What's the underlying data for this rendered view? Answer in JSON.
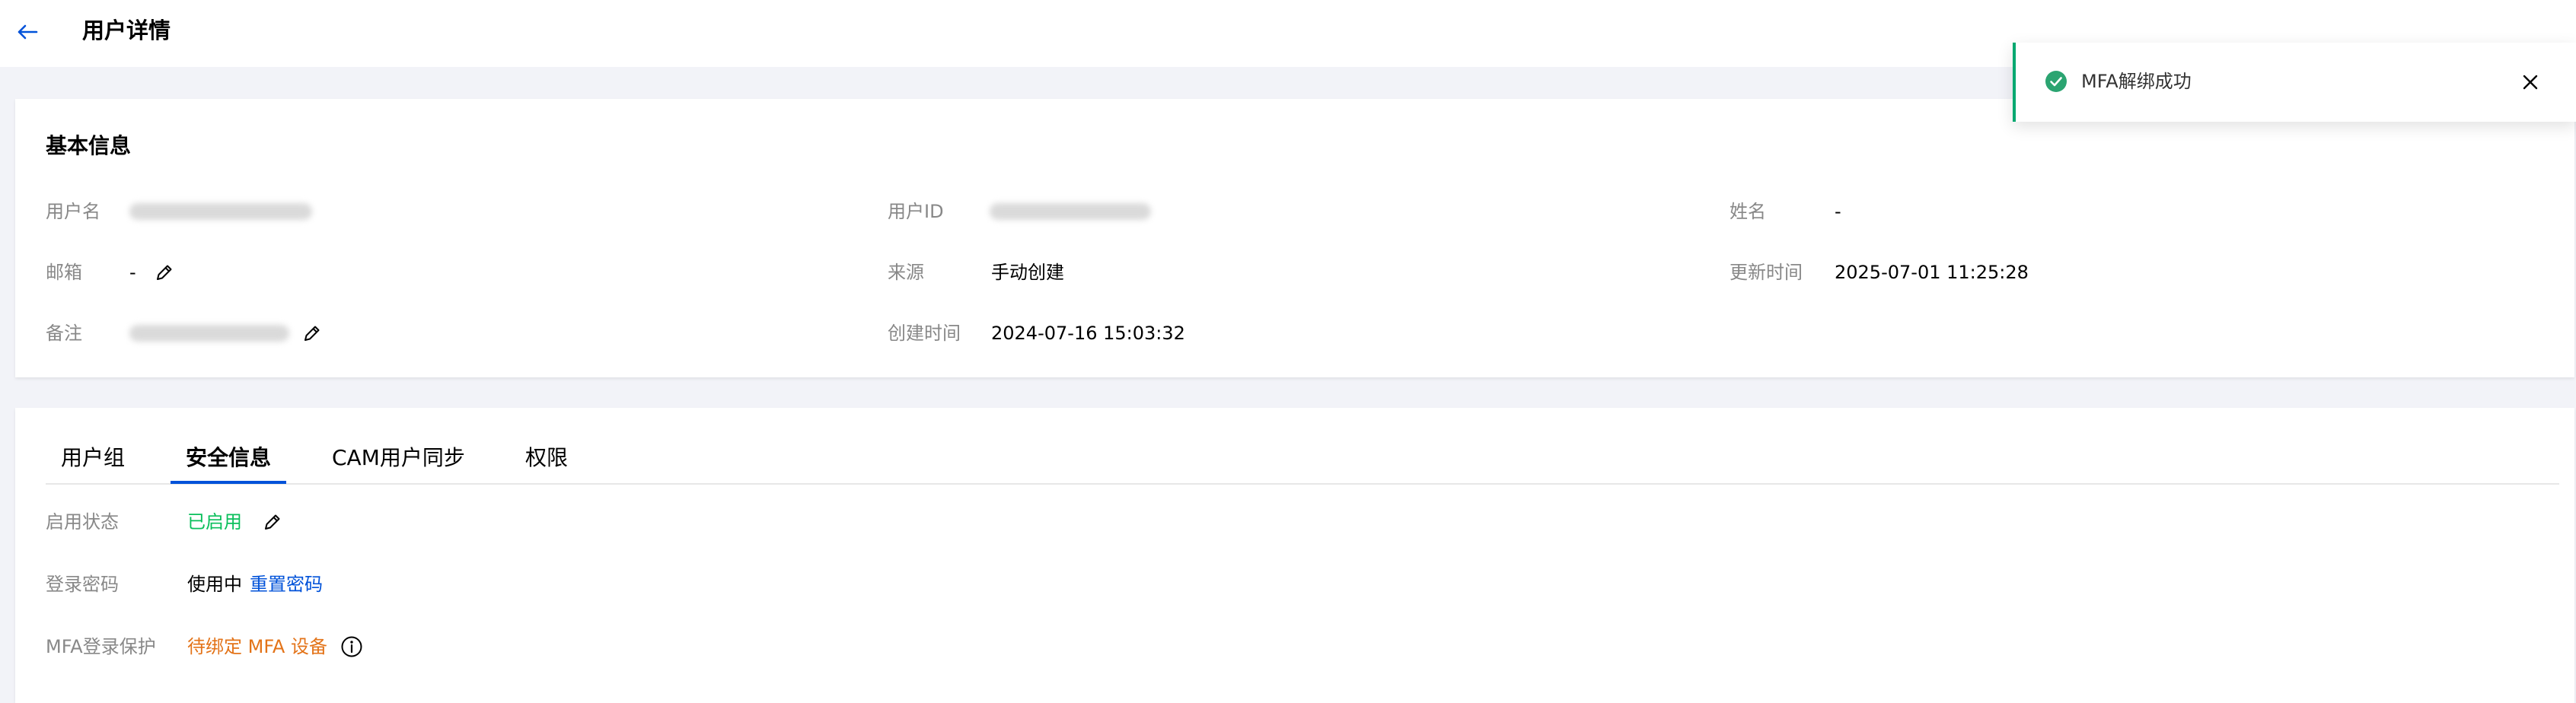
{
  "header": {
    "title": "用户详情",
    "back_icon": "arrow-left-icon"
  },
  "basic_info": {
    "title": "基本信息",
    "fields": {
      "username": {
        "label": "用户名",
        "value": ""
      },
      "user_id": {
        "label": "用户ID",
        "value": ""
      },
      "name": {
        "label": "姓名",
        "value": "-"
      },
      "email": {
        "label": "邮箱",
        "value": "-"
      },
      "source": {
        "label": "来源",
        "value": "手动创建"
      },
      "updated_at": {
        "label": "更新时间",
        "value": "2025-07-01 11:25:28"
      },
      "remark": {
        "label": "备注",
        "value": ""
      },
      "created_at": {
        "label": "创建时间",
        "value": "2024-07-16 15:03:32"
      }
    }
  },
  "tabs": [
    {
      "label": "用户组",
      "active": false
    },
    {
      "label": "安全信息",
      "active": true
    },
    {
      "label": "CAM用户同步",
      "active": false
    },
    {
      "label": "权限",
      "active": false
    }
  ],
  "security": {
    "status": {
      "label": "启用状态",
      "value": "已启用"
    },
    "password": {
      "label": "登录密码",
      "value": "使用中",
      "action": "重置密码"
    },
    "mfa": {
      "label": "MFA登录保护",
      "value": "待绑定 MFA 设备"
    }
  },
  "toast": {
    "message": "MFA解绑成功",
    "icon": "check-circle-icon"
  },
  "colors": {
    "accent": "#0052d9",
    "success": "#0abf5b",
    "warning": "#e37318",
    "toast_border": "#00a870"
  }
}
